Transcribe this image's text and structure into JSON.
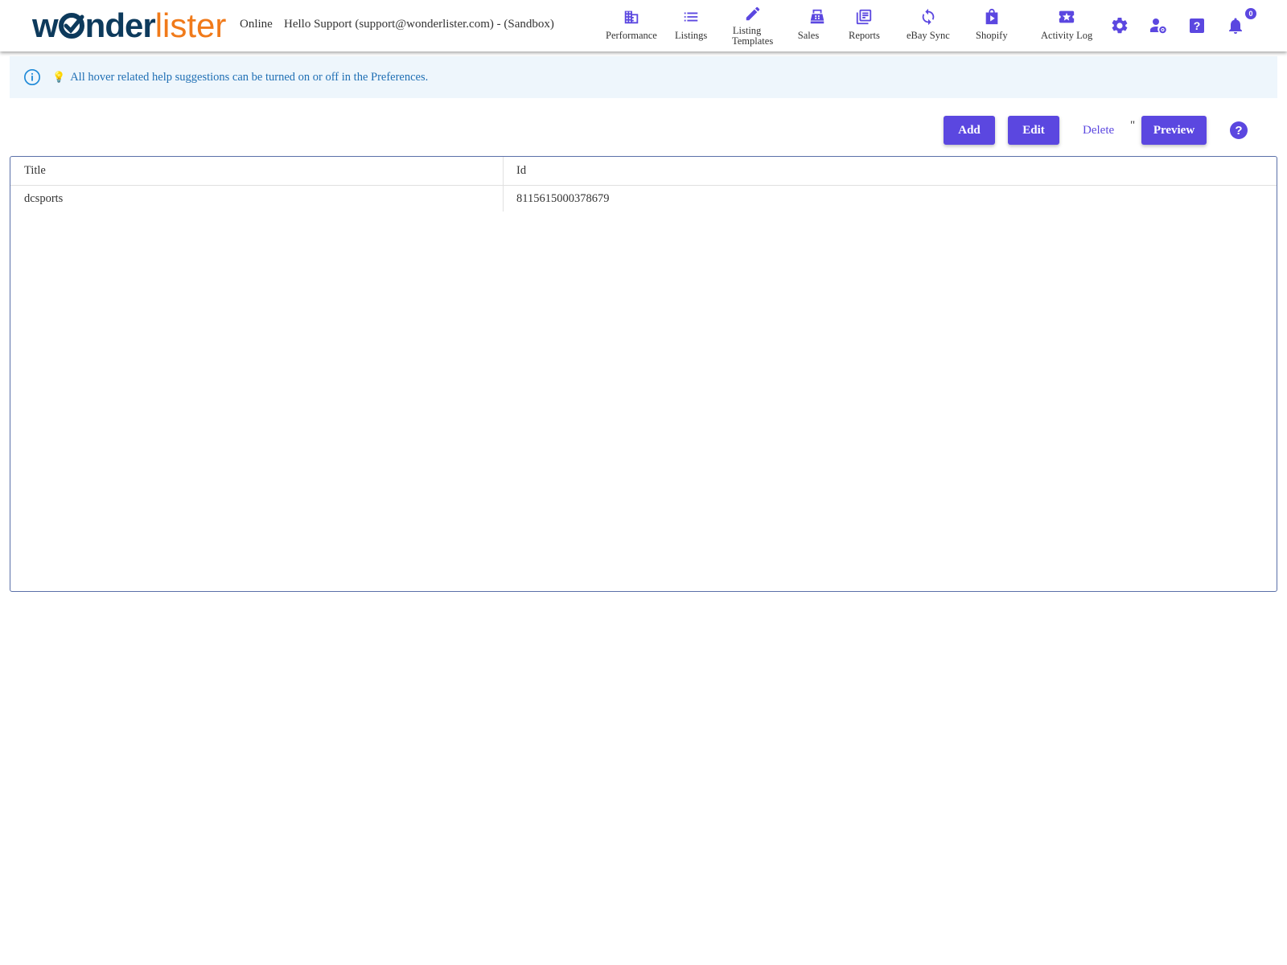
{
  "header": {
    "logo": {
      "part1": "w",
      "part2": "nder",
      "part3": "lister"
    },
    "status": "Online",
    "greeting": "Hello Support (support@wonderlister.com) - (Sandbox)",
    "nav": [
      {
        "label": "Performance",
        "icon": "building-icon"
      },
      {
        "label": "Listings",
        "icon": "list-icon"
      },
      {
        "label1": "Listing",
        "label2": "Templates",
        "icon": "pencil-icon"
      },
      {
        "label": "Sales",
        "icon": "cash-register-icon"
      },
      {
        "label": "Reports",
        "icon": "reports-icon"
      },
      {
        "label": "eBay Sync",
        "icon": "sync-icon"
      },
      {
        "label": "Shopify",
        "icon": "shopify-bag-icon"
      },
      {
        "label": "Activity Log",
        "icon": "activity-ticket-icon"
      }
    ],
    "notification_count": "0"
  },
  "banner": {
    "text": "All hover related help suggestions can be turned on or off in the Preferences.",
    "bulb": "💡"
  },
  "toolbar": {
    "add_label": "Add",
    "edit_label": "Edit",
    "delete_label": "Delete",
    "quote": "\"",
    "preview_label": "Preview"
  },
  "table": {
    "columns": [
      "Title",
      "Id"
    ],
    "rows": [
      {
        "title": "dcsports",
        "id": "8115615000378679"
      }
    ]
  },
  "colors": {
    "accent": "#5b47e0",
    "logo_dark": "#0d3a5c",
    "logo_orange": "#f07a1a",
    "banner_bg": "#eef6fc",
    "banner_text": "#1f6fb4"
  }
}
